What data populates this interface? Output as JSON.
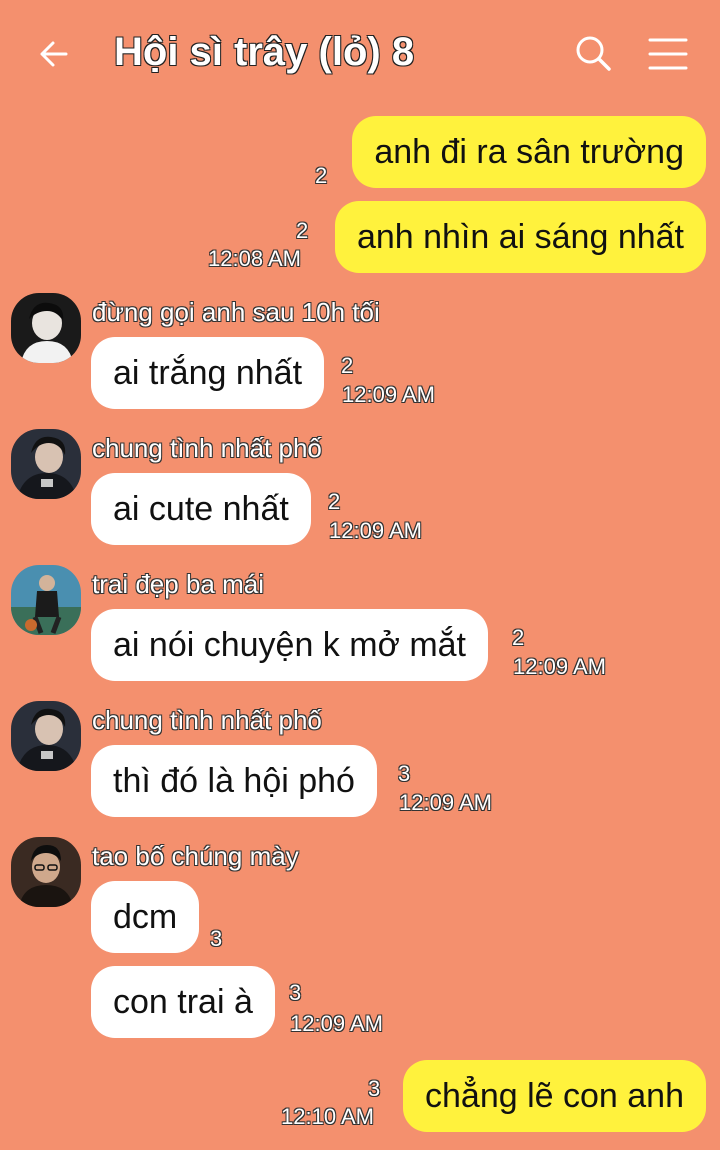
{
  "header": {
    "title": "Hội sì trây (lỏ) 8",
    "back_icon": "arrow-left-icon",
    "search_icon": "search-icon",
    "menu_icon": "hamburger-menu-icon"
  },
  "colors": {
    "background": "#f4906e",
    "my_bubble": "#fff23d",
    "their_bubble": "#ffffff"
  },
  "messages": [
    {
      "text": "anh đi ra sân trường",
      "count": "2"
    },
    {
      "text": "anh nhìn ai sáng nhất",
      "count": "2",
      "time": "12:08 AM"
    },
    {
      "sender": "đừng gọi anh sau 10h tối",
      "text": "ai trắng nhất",
      "count": "2",
      "time": "12:09 AM"
    },
    {
      "sender": "chung tình nhất phố",
      "text": "ai cute nhất",
      "count": "2",
      "time": "12:09 AM"
    },
    {
      "sender": "trai đẹp ba mái",
      "text": "ai nói chuyện k mở mắt",
      "count": "2",
      "time": "12:09 AM"
    },
    {
      "sender": "chung tình nhất phố",
      "text": "thì đó là hội phó",
      "count": "3",
      "time": "12:09 AM"
    },
    {
      "sender": "tao bố chúng mày",
      "text": "dcm",
      "count": "3"
    },
    {
      "text": "con trai à",
      "count": "3",
      "time": "12:09 AM"
    },
    {
      "text": "chẳng lẽ con anh",
      "count": "3",
      "time": "12:10 AM"
    }
  ]
}
